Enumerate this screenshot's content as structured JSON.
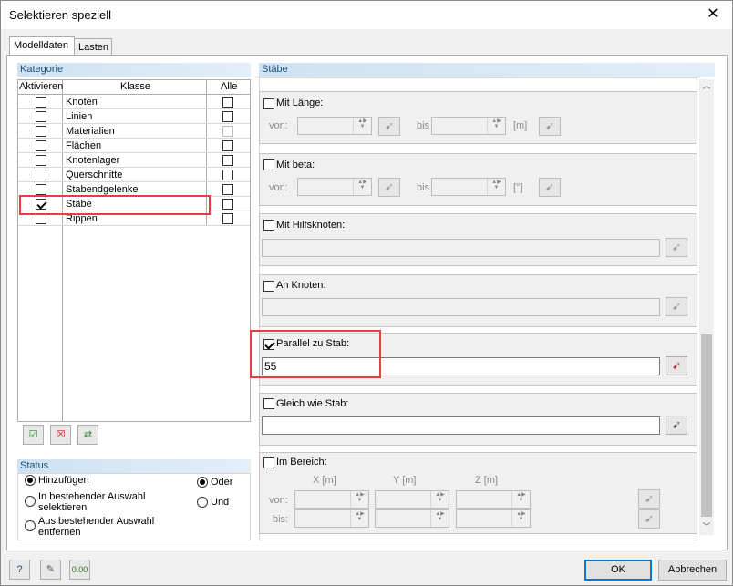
{
  "dialog": {
    "title": "Selektieren speziell",
    "close": "✕"
  },
  "tabs": [
    {
      "label": "Modelldaten"
    },
    {
      "label": "Lasten"
    }
  ],
  "kategorie": {
    "title": "Kategorie",
    "columns": {
      "activate": "Aktivieren",
      "klasse": "Klasse",
      "alle": "Alle"
    },
    "rows": [
      {
        "label": "Knoten",
        "active": false,
        "alle": false,
        "alle_disabled": false
      },
      {
        "label": "Linien",
        "active": false,
        "alle": false,
        "alle_disabled": false
      },
      {
        "label": "Materialien",
        "active": false,
        "alle": false,
        "alle_disabled": true
      },
      {
        "label": "Flächen",
        "active": false,
        "alle": false,
        "alle_disabled": false
      },
      {
        "label": "Knotenlager",
        "active": false,
        "alle": false,
        "alle_disabled": false
      },
      {
        "label": "Querschnitte",
        "active": false,
        "alle": false,
        "alle_disabled": false
      },
      {
        "label": "Stabendgelenke",
        "active": false,
        "alle": false,
        "alle_disabled": false
      },
      {
        "label": "Stäbe",
        "active": true,
        "alle": false,
        "alle_disabled": false
      },
      {
        "label": "Rippen",
        "active": false,
        "alle": false,
        "alle_disabled": false
      }
    ]
  },
  "status": {
    "title": "Status",
    "options": [
      "Hinzufügen",
      "In bestehender Auswahl selektieren",
      "Aus bestehender Auswahl entfernen"
    ],
    "opt2_lines": [
      "In bestehender Auswahl",
      "selektieren"
    ],
    "opt3_lines": [
      "Aus bestehender Auswahl",
      "entfernen"
    ],
    "logic": [
      "Oder",
      "Und"
    ]
  },
  "staebe": {
    "title": "Stäbe",
    "mit_laenge": {
      "label": "Mit Länge:",
      "von": "von:",
      "bis": "bis",
      "unit": "[m]"
    },
    "mit_beta": {
      "label": "Mit beta:",
      "von": "von:",
      "bis": "bis",
      "unit": "[°]"
    },
    "mit_hilfsknoten": {
      "label": "Mit Hilfsknoten:"
    },
    "an_knoten": {
      "label": "An Knoten:"
    },
    "parallel": {
      "label": "Parallel zu Stab:",
      "value": "55"
    },
    "gleich": {
      "label": "Gleich wie Stab:"
    },
    "bereich": {
      "label": "Im Bereich:",
      "x": "X  [m]",
      "y": "Y  [m]",
      "z": "Z  [m]",
      "von": "von:",
      "bis": "bis:"
    }
  },
  "buttons": {
    "ok": "OK",
    "cancel": "Abbrechen"
  }
}
